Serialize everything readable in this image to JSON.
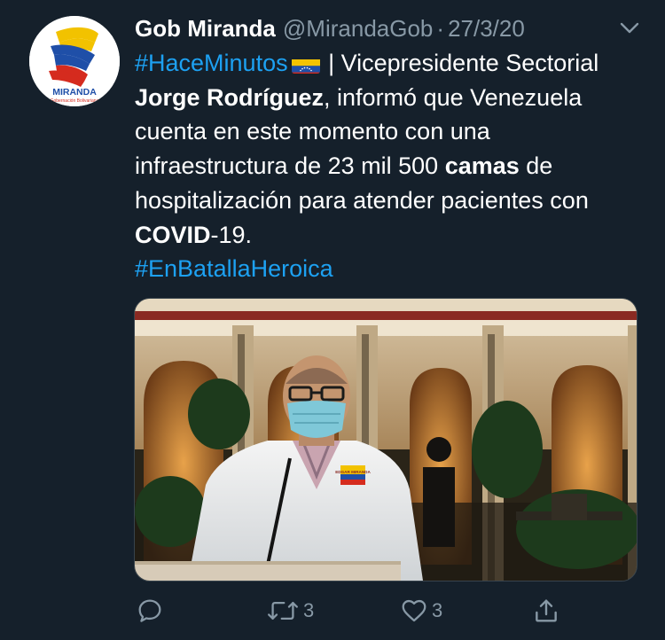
{
  "tweet": {
    "author_name": "Gob Miranda",
    "handle": "@MirandaGob",
    "separator": "·",
    "date": "27/3/20",
    "avatar_text": "MIRANDA",
    "avatar_subtext": "Gobernación Bolivariana",
    "text": {
      "hashtag1": "#HaceMinutos",
      "flag_icon": "venezuela-flag",
      "p1": " | Vicepresidente Sectorial ",
      "b1": "Jorge Rodríguez",
      "p2": ", informó que Venezuela cuenta en este momento con una infraestructura de 23 mil 500 ",
      "b2": "camas",
      "p3": " de hospitalización para atender pacientes con ",
      "b3": "COVID",
      "p4": "-19.",
      "hashtag2": "#EnBatallaHeroica"
    },
    "media": {
      "badge_text": "EDGAR MIRANDA"
    },
    "actions": {
      "reply_count": "",
      "retweet_count": "3",
      "like_count": "3"
    }
  },
  "colors": {
    "background": "#15202b",
    "text": "#ffffff",
    "secondary": "#8899a6",
    "link": "#1da1f2"
  }
}
